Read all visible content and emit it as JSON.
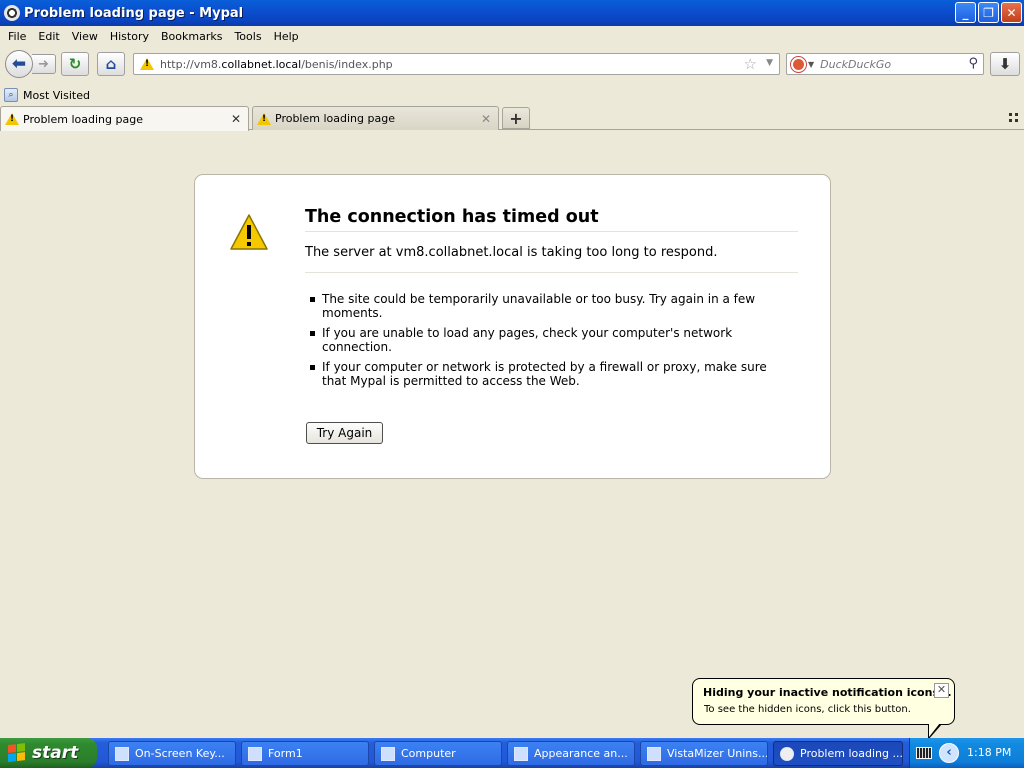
{
  "window": {
    "title": "Problem loading page - Mypal"
  },
  "menu": {
    "items": [
      "File",
      "Edit",
      "View",
      "History",
      "Bookmarks",
      "Tools",
      "Help"
    ]
  },
  "nav": {
    "url_prefix": "http://vm8.",
    "url_host": "collabnet.local",
    "url_path": "/benis/index.php",
    "search_placeholder": "DuckDuckGo"
  },
  "bookmarks": {
    "most_visited": "Most Visited"
  },
  "tabs": [
    {
      "label": "Problem loading page",
      "active": true
    },
    {
      "label": "Problem loading page",
      "active": false
    }
  ],
  "error": {
    "title": "The connection has timed out",
    "short_desc": "The server at vm8.collabnet.local is taking too long to respond.",
    "bullets": [
      "The site could be temporarily unavailable or too busy. Try again in a few moments.",
      "If you are unable to load any pages, check your computer's network connection.",
      "If your computer or network is protected by a firewall or proxy, make sure that Mypal is permitted to access the Web."
    ],
    "try_again": "Try Again"
  },
  "balloon": {
    "title": "Hiding your inactive notification icons...",
    "text": "To see the hidden icons, click this button."
  },
  "taskbar": {
    "start": "start",
    "items": [
      {
        "label": "On-Screen Key..."
      },
      {
        "label": "Form1"
      },
      {
        "label": "Computer"
      },
      {
        "label": "Appearance an..."
      },
      {
        "label": "VistaMizer Unins..."
      },
      {
        "label": "Problem loading ..."
      }
    ],
    "clock": "1:18 PM"
  },
  "colors": {
    "titlebar": "#0b4fcf",
    "taskbar": "#245edb",
    "start": "#2f8b2f",
    "warning": "#f2c600"
  }
}
